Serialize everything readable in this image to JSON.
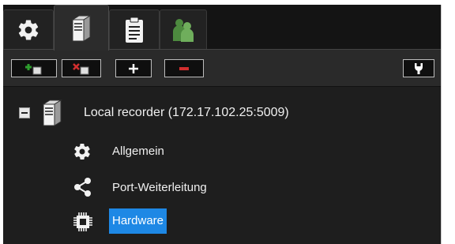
{
  "tabs": [
    {
      "id": "settings",
      "icon": "gear-icon"
    },
    {
      "id": "recorder",
      "icon": "server-icon"
    },
    {
      "id": "clipboard",
      "icon": "clipboard-icon"
    },
    {
      "id": "users",
      "icon": "users-icon"
    }
  ],
  "toolbar": {
    "buttons": [
      {
        "id": "add-recorder",
        "icon": "add-recorder-icon"
      },
      {
        "id": "remove-recorder",
        "icon": "remove-recorder-icon"
      },
      {
        "id": "add",
        "label": "+"
      },
      {
        "id": "remove",
        "label": "−"
      },
      {
        "id": "tools",
        "icon": "wrench-icon"
      }
    ]
  },
  "tree": {
    "root": {
      "label": "Local recorder (172.17.102.25:5009)",
      "icon": "server-icon",
      "expanded": true,
      "children": [
        {
          "label": "Allgemein",
          "icon": "gear-icon"
        },
        {
          "label": "Port-Weiterleitung",
          "icon": "share-icon"
        },
        {
          "label": "Hardware",
          "icon": "chip-icon",
          "selected": true
        }
      ]
    }
  },
  "colors": {
    "background": "#1e1e1e",
    "selection": "#1e88e5",
    "add_green": "#2e9e2e",
    "remove_red": "#d32f2f",
    "users_green": "#5a9a4a"
  }
}
